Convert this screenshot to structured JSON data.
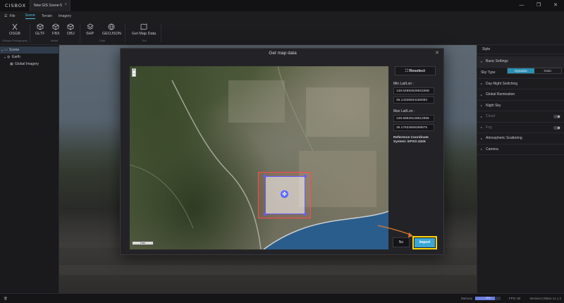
{
  "app": {
    "logo": "CISBOX",
    "document_tab": "New GIS Scene-5",
    "window_controls": [
      "—",
      "❐",
      "✕"
    ]
  },
  "menu": {
    "file": "File",
    "tabs": [
      {
        "label": "Scene",
        "active": true
      },
      {
        "label": "Terrain",
        "active": false
      },
      {
        "label": "Imagery",
        "active": false
      }
    ]
  },
  "toolbar": {
    "tools": [
      {
        "label": "OSGB",
        "icon": "scissors-icon"
      },
      {
        "label": "GLTF",
        "icon": "cube-icon"
      },
      {
        "label": "FBX",
        "icon": "cube-icon"
      },
      {
        "label": "OBJ",
        "icon": "cube-icon"
      },
      {
        "label": "SHP",
        "icon": "layers-icon"
      },
      {
        "label": "GEOJSON",
        "icon": "globe-icon"
      },
      {
        "label": "Get Map Data",
        "icon": "map-icon"
      }
    ],
    "groups": [
      "Oblique Photography",
      "Model",
      "Data",
      "Tool"
    ]
  },
  "scene_tree": {
    "items": [
      {
        "label": "Scene",
        "level": 0,
        "selected": true
      },
      {
        "label": "Earth",
        "level": 1,
        "selected": false
      },
      {
        "label": "Global Imagery",
        "level": 2,
        "selected": false
      }
    ]
  },
  "right_panel": {
    "tab": "Style",
    "basic_settings": "Basic Settings",
    "sky_type_label": "Sky Type",
    "sky_type_options": [
      "Dynamic",
      "Static"
    ],
    "sky_type_selected": "Dynamic",
    "sections": [
      {
        "label": "Day-Night Switching",
        "disabled": false,
        "toggle": false
      },
      {
        "label": "Global Illumination",
        "disabled": false,
        "toggle": false
      },
      {
        "label": "Night Sky",
        "disabled": false,
        "toggle": false
      },
      {
        "label": "Cloud",
        "disabled": true,
        "toggle": true
      },
      {
        "label": "Fog",
        "disabled": true,
        "toggle": true
      },
      {
        "label": "Atmospheric Scattering",
        "disabled": false,
        "toggle": false
      },
      {
        "label": "Camera",
        "disabled": false,
        "toggle": false
      }
    ]
  },
  "modal": {
    "title": "Get map data",
    "reselect_label": "Reselect",
    "min_label": "Min Lat/Lon :",
    "min_lon": "138.64892626823368",
    "min_lat": "35.14345944158383",
    "max_label": "Max Lat/Lon :",
    "max_lon": "138.68929128612996",
    "max_lat": "35.17634606298875",
    "reference_label": "Reference Coordinate System:",
    "reference_value": "EPSG:4326",
    "map_scale": "2 km",
    "no_label": "No",
    "import_label": "Import",
    "colors": {
      "import": "#3aa6d6",
      "highlight": "#ffd60a",
      "selection": "#6a5cff"
    }
  },
  "status": {
    "memory_label": "Memory",
    "memory_percent": "79%",
    "memory_fraction": 0.79,
    "fps": "FPS: 60",
    "version": "Version:CISBox v1.1.2"
  }
}
